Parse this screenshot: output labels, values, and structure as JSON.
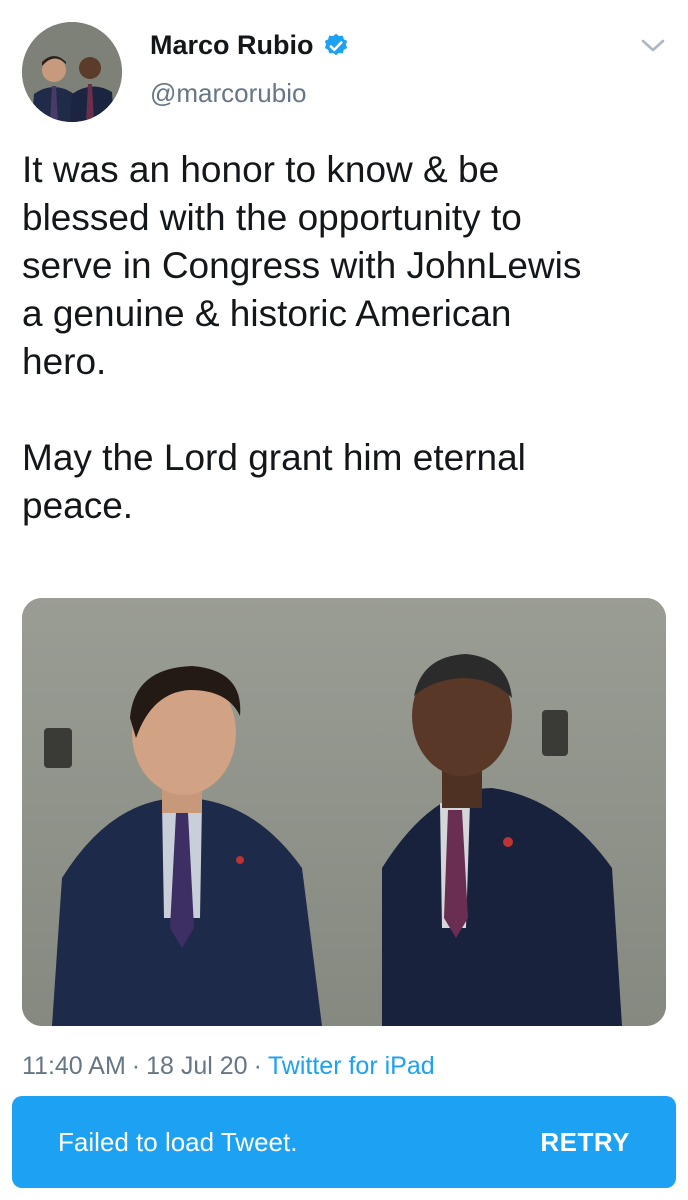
{
  "user": {
    "display_name": "Marco Rubio",
    "handle": "@marcorubio",
    "verified_icon": "verified-badge-icon",
    "menu_icon": "chevron-down-icon"
  },
  "tweet": {
    "text": "It was an honor to know & be\nblessed with the opportunity to\nserve in Congress with JohnLewis\na genuine & historic American\nhero.\n\nMay the Lord grant him eternal\npeace."
  },
  "meta": {
    "time": "11:40 AM",
    "separator": "·",
    "date": "18 Jul 20",
    "source": "Twitter for iPad"
  },
  "toast": {
    "message": "Failed to load Tweet.",
    "action": "RETRY"
  },
  "colors": {
    "accent": "#1da1f2",
    "text": "#14171a",
    "secondary": "#657786"
  }
}
